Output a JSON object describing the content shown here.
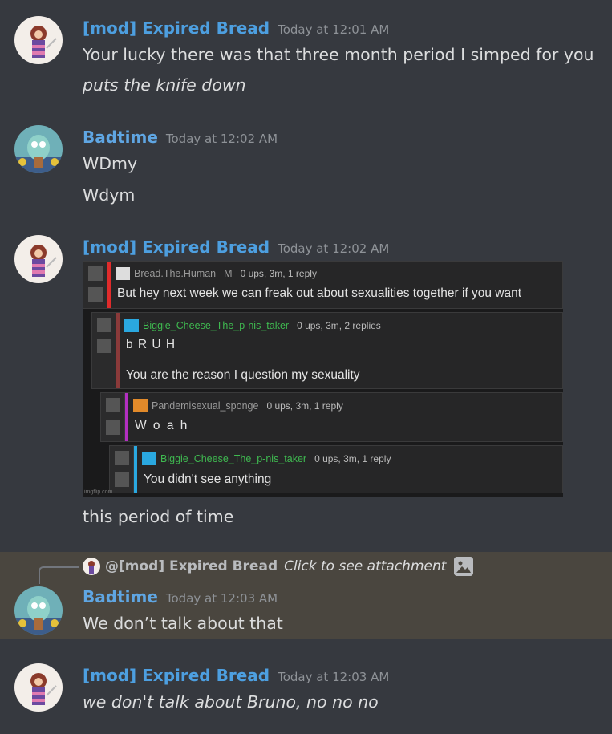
{
  "messages": [
    {
      "author": "[mod] Expired Bread",
      "timestamp": "Today at 12:01 AM",
      "lines": [
        "Your lucky there was that three month period I simped for you",
        "puts the knife down"
      ]
    },
    {
      "author": "Badtime",
      "timestamp": "Today at 12:02 AM",
      "lines": [
        "WDmy",
        "Wdym"
      ]
    },
    {
      "author": "[mod] Expired Bread",
      "timestamp": "Today at 12:02 AM",
      "lines": [
        "this period of time"
      ]
    },
    {
      "author": "Badtime",
      "timestamp": "Today at 12:03 AM",
      "lines": [
        "We don’t talk about that"
      ],
      "reply": {
        "to": "@[mod] Expired Bread",
        "preview": "Click to see attachment"
      }
    },
    {
      "author": "[mod] Expired Bread",
      "timestamp": "Today at 12:03 AM",
      "lines": [
        "we don't talk about Bruno, no no no"
      ]
    }
  ],
  "embed": {
    "watermark": "imgflip.com",
    "comments": [
      {
        "user": "Bread.The.Human",
        "flag": "M",
        "meta": "0 ups, 3m, 1 reply",
        "lines": [
          "But hey next week we can freak out about sexualities together if you want"
        ],
        "bar_color": "#e02b2b",
        "name_color": "#9a9a9a"
      },
      {
        "user": "Biggie_Cheese_The_p-nis_taker",
        "meta": "0 ups, 3m, 2 replies",
        "lines": [
          "b R U H",
          "You are the reason I question my sexuality"
        ],
        "bar_color": "#8a3a3a",
        "name_color": "#3fb950"
      },
      {
        "user": "Pandemisexual_sponge",
        "meta": "0 ups, 3m, 1 reply",
        "lines": [
          "W o a h"
        ],
        "bar_color": "#b32fc2",
        "name_color": "#9a9a9a"
      },
      {
        "user": "Biggie_Cheese_The_p-nis_taker",
        "meta": "0 ups, 3m, 1 reply",
        "lines": [
          "You didn't see anything"
        ],
        "bar_color": "#2aa8e0",
        "name_color": "#3fb950"
      }
    ]
  },
  "colors": {
    "background": "#36393f",
    "mod_name": "#4d9fe0",
    "badtime_name": "#5fa6e3",
    "reply_highlight": "#4a463f"
  }
}
